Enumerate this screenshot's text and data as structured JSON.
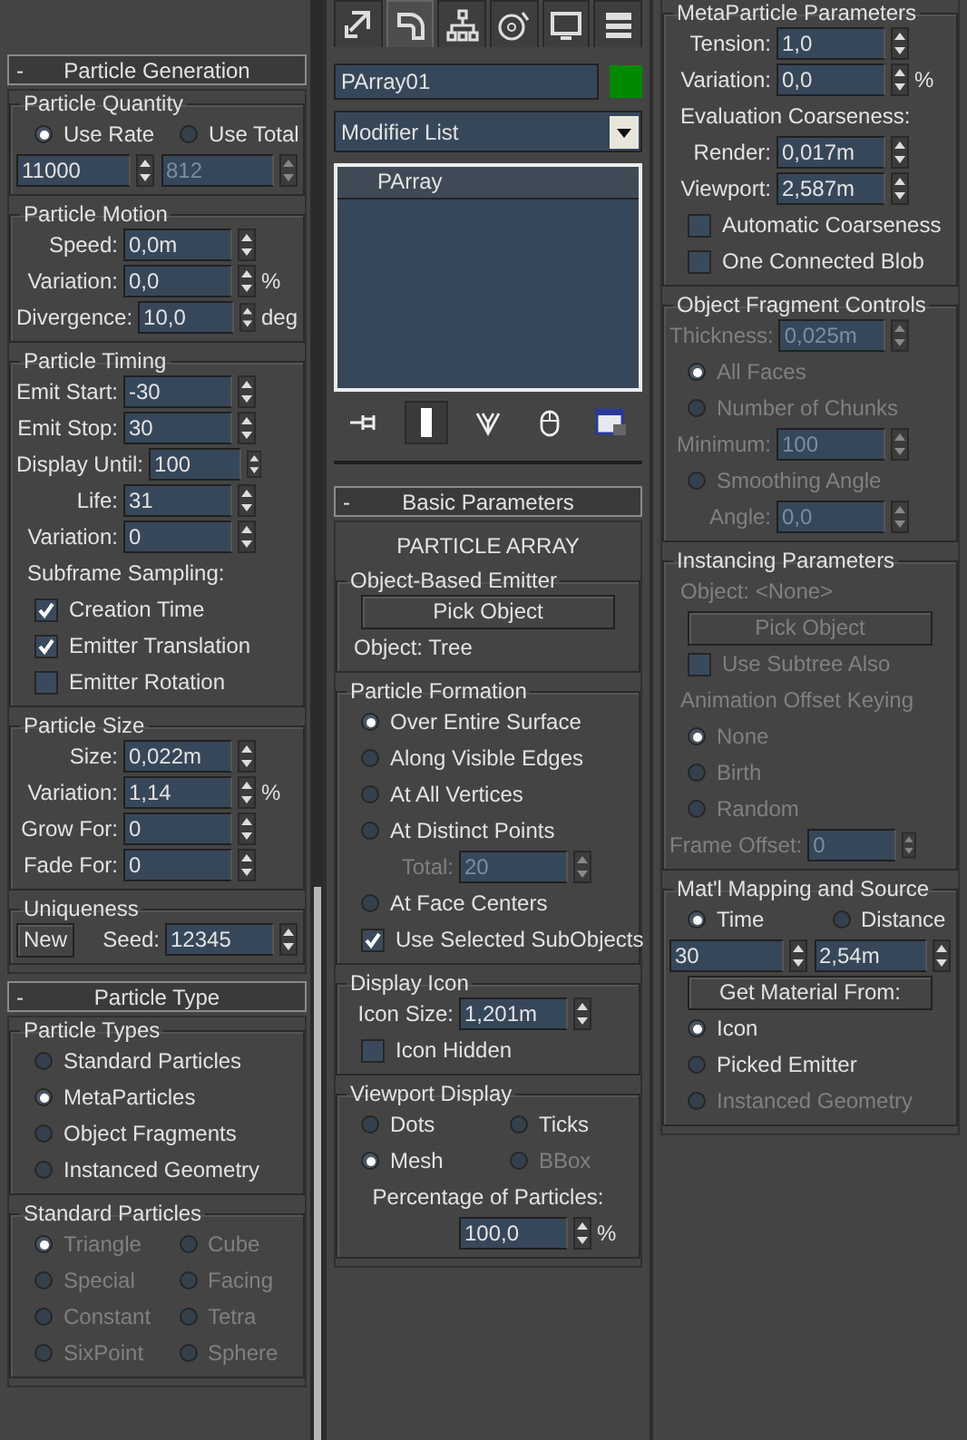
{
  "columns": [
    {
      "blocks": [
        {
          "kind": "rollout",
          "sign": "-",
          "title": "Particle Generation",
          "body": [
            {
              "kind": "group",
              "title": "Particle Quantity",
              "items": [
                {
                  "kind": "row",
                  "cells": [
                    {
                      "kind": "radio",
                      "label": "Use Rate",
                      "selected": true,
                      "disabled": false
                    },
                    {
                      "kind": "radio",
                      "label": "Use Total",
                      "selected": false,
                      "disabled": false
                    }
                  ]
                },
                {
                  "kind": "row",
                  "cells": [
                    {
                      "kind": "spinner",
                      "value": "11000",
                      "disabled": false
                    },
                    {
                      "kind": "spinner",
                      "value": "812",
                      "disabled": true
                    }
                  ]
                }
              ]
            },
            {
              "kind": "group",
              "title": "Particle Motion",
              "items": [
                {
                  "kind": "spinner",
                  "label": "Speed:",
                  "value": "0,0m",
                  "disabled": false
                },
                {
                  "kind": "spinner",
                  "label": "Variation:",
                  "value": "0,0",
                  "unit": "%",
                  "disabled": false
                },
                {
                  "kind": "spinner",
                  "label": "Divergence:",
                  "value": "10,0",
                  "unit": "deg",
                  "disabled": false
                }
              ]
            },
            {
              "kind": "group",
              "title": "Particle Timing",
              "items": [
                {
                  "kind": "spinner",
                  "label": "Emit Start:",
                  "value": "-30",
                  "disabled": false
                },
                {
                  "kind": "spinner",
                  "label": "Emit Stop:",
                  "value": "30",
                  "disabled": false
                },
                {
                  "kind": "spinner",
                  "label": "Display Until:",
                  "value": "100",
                  "disabled": false
                },
                {
                  "kind": "spinner",
                  "label": "Life:",
                  "value": "31",
                  "disabled": false
                },
                {
                  "kind": "spinner",
                  "label": "Variation:",
                  "value": "0",
                  "disabled": false
                },
                {
                  "kind": "text",
                  "text": "Subframe Sampling:",
                  "disabled": false
                },
                {
                  "kind": "check",
                  "label": "Creation Time",
                  "checked": true,
                  "disabled": false
                },
                {
                  "kind": "check",
                  "label": "Emitter Translation",
                  "checked": true,
                  "disabled": false
                },
                {
                  "kind": "check",
                  "label": "Emitter Rotation",
                  "checked": false,
                  "disabled": false
                }
              ]
            },
            {
              "kind": "group",
              "title": "Particle Size",
              "items": [
                {
                  "kind": "spinner",
                  "label": "Size:",
                  "value": "0,022m",
                  "disabled": false
                },
                {
                  "kind": "spinner",
                  "label": "Variation:",
                  "value": "1,14",
                  "unit": "%",
                  "disabled": false
                },
                {
                  "kind": "spinner",
                  "label": "Grow For:",
                  "value": "0",
                  "disabled": false
                },
                {
                  "kind": "spinner",
                  "label": "Fade For:",
                  "value": "0",
                  "disabled": false
                }
              ]
            },
            {
              "kind": "group",
              "title": "Uniqueness",
              "items": [
                {
                  "kind": "row",
                  "cells": [
                    {
                      "kind": "button",
                      "label": "New",
                      "disabled": false
                    },
                    {
                      "kind": "spinner",
                      "label": "Seed:",
                      "value": "12345",
                      "disabled": false
                    }
                  ]
                }
              ]
            }
          ]
        },
        {
          "kind": "rollout",
          "sign": "-",
          "title": "Particle Type",
          "body": [
            {
              "kind": "group",
              "title": "Particle Types",
              "items": [
                {
                  "kind": "radio",
                  "label": "Standard Particles",
                  "selected": false,
                  "disabled": false
                },
                {
                  "kind": "radio",
                  "label": "MetaParticles",
                  "selected": true,
                  "disabled": false
                },
                {
                  "kind": "radio",
                  "label": "Object Fragments",
                  "selected": false,
                  "disabled": false
                },
                {
                  "kind": "radio",
                  "label": "Instanced Geometry",
                  "selected": false,
                  "disabled": false
                }
              ]
            },
            {
              "kind": "group",
              "title": "Standard Particles",
              "items": [
                {
                  "kind": "row",
                  "cells": [
                    {
                      "kind": "radio",
                      "label": "Triangle",
                      "selected": true,
                      "disabled": true
                    },
                    {
                      "kind": "radio",
                      "label": "Cube",
                      "selected": false,
                      "disabled": true
                    }
                  ]
                },
                {
                  "kind": "row",
                  "cells": [
                    {
                      "kind": "radio",
                      "label": "Special",
                      "selected": false,
                      "disabled": true
                    },
                    {
                      "kind": "radio",
                      "label": "Facing",
                      "selected": false,
                      "disabled": true
                    }
                  ]
                },
                {
                  "kind": "row",
                  "cells": [
                    {
                      "kind": "radio",
                      "label": "Constant",
                      "selected": false,
                      "disabled": true
                    },
                    {
                      "kind": "radio",
                      "label": "Tetra",
                      "selected": false,
                      "disabled": true
                    }
                  ]
                },
                {
                  "kind": "row",
                  "cells": [
                    {
                      "kind": "radio",
                      "label": "SixPoint",
                      "selected": false,
                      "disabled": true
                    },
                    {
                      "kind": "radio",
                      "label": "Sphere",
                      "selected": false,
                      "disabled": true
                    }
                  ]
                }
              ]
            }
          ]
        }
      ]
    },
    {
      "blocks": [
        {
          "kind": "tabs",
          "tabs": [
            {
              "selected": false
            },
            {
              "selected": true
            },
            {
              "selected": false
            },
            {
              "selected": false
            },
            {
              "selected": false
            },
            {
              "selected": false
            }
          ]
        },
        {
          "kind": "name",
          "value": "PArray01",
          "color": "#008a00"
        },
        {
          "kind": "dropdown",
          "value": "Modifier List"
        },
        {
          "kind": "stack",
          "items": [
            {
              "label": "PArray"
            }
          ]
        },
        {
          "kind": "toolbar",
          "buttons": [
            {
              "active": false
            },
            {
              "active": true
            },
            {
              "active": false
            },
            {
              "active": false
            },
            {
              "active": false
            }
          ]
        },
        {
          "kind": "rollout",
          "sign": "-",
          "title": "Basic Parameters",
          "body": [
            {
              "kind": "title",
              "text": "PARTICLE ARRAY"
            },
            {
              "kind": "group",
              "title": "Object-Based Emitter",
              "items": [
                {
                  "kind": "button",
                  "label": "Pick Object",
                  "disabled": false
                },
                {
                  "kind": "text",
                  "text": "Object: Tree",
                  "disabled": false
                }
              ]
            },
            {
              "kind": "group",
              "title": "Particle Formation",
              "items": [
                {
                  "kind": "radio",
                  "label": "Over Entire Surface",
                  "selected": true,
                  "disabled": false
                },
                {
                  "kind": "radio",
                  "label": "Along Visible Edges",
                  "selected": false,
                  "disabled": false
                },
                {
                  "kind": "radio",
                  "label": "At All Vertices",
                  "selected": false,
                  "disabled": false
                },
                {
                  "kind": "radio",
                  "label": "At Distinct Points",
                  "selected": false,
                  "disabled": false
                },
                {
                  "kind": "spinner",
                  "label": "Total:",
                  "value": "20",
                  "disabled": true
                },
                {
                  "kind": "radio",
                  "label": "At Face Centers",
                  "selected": false,
                  "disabled": false
                },
                {
                  "kind": "check",
                  "label": "Use Selected SubObjects",
                  "checked": true,
                  "disabled": false
                }
              ]
            },
            {
              "kind": "group",
              "title": "Display Icon",
              "items": [
                {
                  "kind": "spinner",
                  "label": "Icon Size:",
                  "value": "1,201m",
                  "disabled": false
                },
                {
                  "kind": "check",
                  "label": "Icon Hidden",
                  "checked": false,
                  "disabled": false
                }
              ]
            },
            {
              "kind": "group",
              "title": "Viewport Display",
              "items": [
                {
                  "kind": "row",
                  "cells": [
                    {
                      "kind": "radio",
                      "label": "Dots",
                      "selected": false,
                      "disabled": false
                    },
                    {
                      "kind": "radio",
                      "label": "Ticks",
                      "selected": false,
                      "disabled": false
                    }
                  ]
                },
                {
                  "kind": "row",
                  "cells": [
                    {
                      "kind": "radio",
                      "label": "Mesh",
                      "selected": true,
                      "disabled": false
                    },
                    {
                      "kind": "radio",
                      "label": "BBox",
                      "selected": false,
                      "disabled": true
                    }
                  ]
                },
                {
                  "kind": "caption",
                  "text": "Percentage of Particles:",
                  "disabled": false
                },
                {
                  "kind": "spinner",
                  "value": "100,0",
                  "unit": "%",
                  "disabled": false
                }
              ]
            }
          ]
        }
      ]
    },
    {
      "blocks": [
        {
          "kind": "rollout",
          "body": [
            {
              "kind": "group",
              "title": "MetaParticle Parameters",
              "items": [
                {
                  "kind": "spinner",
                  "label": "Tension:",
                  "value": "1,0",
                  "disabled": false
                },
                {
                  "kind": "spinner",
                  "label": "Variation:",
                  "value": "0,0",
                  "unit": "%",
                  "disabled": false
                },
                {
                  "kind": "text",
                  "text": "Evaluation Coarseness:",
                  "disabled": false
                },
                {
                  "kind": "spinner",
                  "label": "Render:",
                  "value": "0,017m",
                  "disabled": false
                },
                {
                  "kind": "spinner",
                  "label": "Viewport:",
                  "value": "2,587m",
                  "disabled": false
                },
                {
                  "kind": "check",
                  "label": "Automatic Coarseness",
                  "checked": false,
                  "disabled": false
                },
                {
                  "kind": "check",
                  "label": "One Connected Blob",
                  "checked": false,
                  "disabled": false
                }
              ]
            },
            {
              "kind": "group",
              "title": "Object Fragment Controls",
              "items": [
                {
                  "kind": "spinner",
                  "label": "Thickness:",
                  "value": "0,025m",
                  "disabled": true
                },
                {
                  "kind": "radio",
                  "label": "All Faces",
                  "selected": true,
                  "disabled": true
                },
                {
                  "kind": "radio",
                  "label": "Number of Chunks",
                  "selected": false,
                  "disabled": true
                },
                {
                  "kind": "spinner",
                  "label": "Minimum:",
                  "value": "100",
                  "disabled": true
                },
                {
                  "kind": "radio",
                  "label": "Smoothing Angle",
                  "selected": false,
                  "disabled": true
                },
                {
                  "kind": "spinner",
                  "label": "Angle:",
                  "value": "0,0",
                  "disabled": true
                }
              ]
            },
            {
              "kind": "group",
              "title": "Instancing Parameters",
              "items": [
                {
                  "kind": "text",
                  "text": "Object: <None>",
                  "disabled": true
                },
                {
                  "kind": "button",
                  "label": "Pick Object",
                  "disabled": true
                },
                {
                  "kind": "check",
                  "label": "Use Subtree Also",
                  "checked": false,
                  "disabled": true
                },
                {
                  "kind": "text",
                  "text": "Animation Offset Keying",
                  "disabled": true
                },
                {
                  "kind": "radio",
                  "label": "None",
                  "selected": true,
                  "disabled": true
                },
                {
                  "kind": "radio",
                  "label": "Birth",
                  "selected": false,
                  "disabled": true
                },
                {
                  "kind": "radio",
                  "label": "Random",
                  "selected": false,
                  "disabled": true
                },
                {
                  "kind": "spinner",
                  "label": "Frame Offset:",
                  "value": "0",
                  "disabled": true
                }
              ]
            },
            {
              "kind": "group",
              "title": "Mat'l Mapping and Source",
              "items": [
                {
                  "kind": "row",
                  "cells": [
                    {
                      "kind": "radio",
                      "label": "Time",
                      "selected": true,
                      "disabled": false
                    },
                    {
                      "kind": "radio",
                      "label": "Distance",
                      "selected": false,
                      "disabled": false
                    }
                  ]
                },
                {
                  "kind": "row",
                  "cells": [
                    {
                      "kind": "spinner",
                      "value": "30",
                      "disabled": false
                    },
                    {
                      "kind": "spinner",
                      "value": "2,54m",
                      "disabled": false
                    }
                  ]
                },
                {
                  "kind": "button",
                  "label": "Get Material From:",
                  "disabled": false
                },
                {
                  "kind": "radio",
                  "label": "Icon",
                  "selected": true,
                  "disabled": false
                },
                {
                  "kind": "radio",
                  "label": "Picked Emitter",
                  "selected": false,
                  "disabled": false
                },
                {
                  "kind": "radio",
                  "label": "Instanced Geometry",
                  "selected": false,
                  "disabled": true
                }
              ]
            }
          ]
        }
      ]
    }
  ]
}
